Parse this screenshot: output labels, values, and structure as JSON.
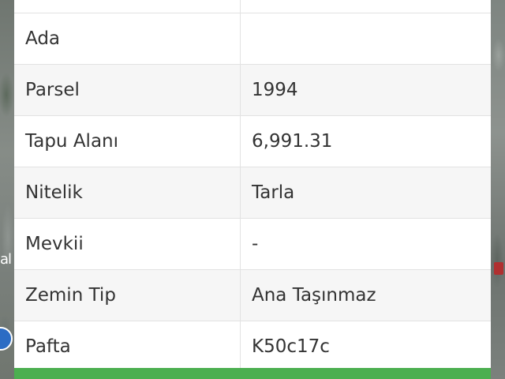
{
  "table": {
    "rows": [
      {
        "label": "",
        "value": ""
      },
      {
        "label": "Ada",
        "value": ""
      },
      {
        "label": "Parsel",
        "value": "1994"
      },
      {
        "label": "Tapu Alanı",
        "value": "6,991.31"
      },
      {
        "label": "Nitelik",
        "value": "Tarla"
      },
      {
        "label": "Mevkii",
        "value": "-"
      },
      {
        "label": "Zemin Tip",
        "value": "Ana Taşınmaz"
      },
      {
        "label": "Pafta",
        "value": "K50c17c"
      }
    ]
  },
  "map": {
    "label_fragment": "al"
  },
  "colors": {
    "accent_green": "#4caf50",
    "panel_background": "#ffffff",
    "row_alt_background": "#f6f6f6",
    "text": "#333333",
    "map_button_blue": "#2b6cc4"
  },
  "icons": {
    "map_button": "location-icon"
  }
}
